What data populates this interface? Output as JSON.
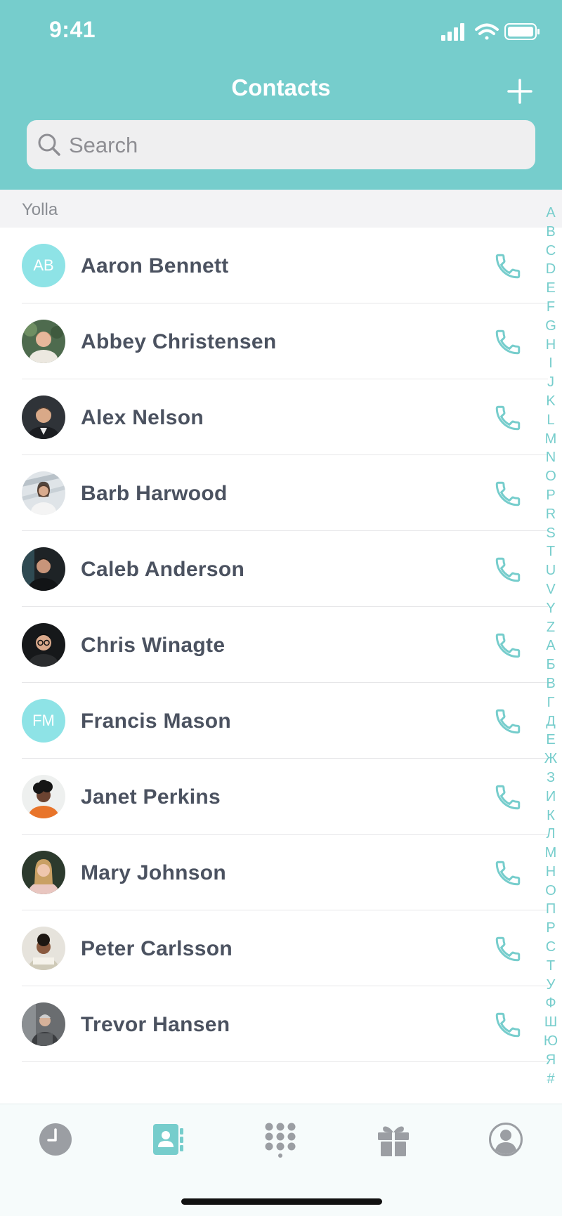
{
  "status_bar": {
    "time": "9:41"
  },
  "header": {
    "title": "Contacts",
    "add_icon": "plus-icon"
  },
  "search": {
    "placeholder": "Search",
    "icon": "search-icon"
  },
  "section": {
    "label": "Yolla"
  },
  "contacts": [
    {
      "name": "Aaron Bennett",
      "initials": "AB",
      "avatar": "initials"
    },
    {
      "name": "Abbey Christensen",
      "initials": "",
      "avatar": "photo"
    },
    {
      "name": "Alex Nelson",
      "initials": "",
      "avatar": "photo"
    },
    {
      "name": "Barb Harwood",
      "initials": "",
      "avatar": "photo"
    },
    {
      "name": "Caleb Anderson",
      "initials": "",
      "avatar": "photo"
    },
    {
      "name": "Chris Winagte",
      "initials": "",
      "avatar": "photo"
    },
    {
      "name": "Francis Mason",
      "initials": "FM",
      "avatar": "initials"
    },
    {
      "name": "Janet Perkins",
      "initials": "",
      "avatar": "photo"
    },
    {
      "name": "Mary Johnson",
      "initials": "",
      "avatar": "photo"
    },
    {
      "name": "Peter Carlsson",
      "initials": "",
      "avatar": "photo"
    },
    {
      "name": "Trevor Hansen",
      "initials": "",
      "avatar": "photo"
    }
  ],
  "index_letters": [
    "A",
    "B",
    "C",
    "D",
    "E",
    "F",
    "G",
    "H",
    "I",
    "J",
    "K",
    "L",
    "M",
    "N",
    "O",
    "P",
    "R",
    "S",
    "T",
    "U",
    "V",
    "Y",
    "Z",
    "А",
    "Б",
    "В",
    "Г",
    "Д",
    "Е",
    "Ж",
    "З",
    "И",
    "К",
    "Л",
    "М",
    "Н",
    "О",
    "П",
    "Р",
    "С",
    "Т",
    "У",
    "Ф",
    "Ш",
    "Ю",
    "Я",
    "#"
  ],
  "tabs": [
    {
      "icon": "clock-icon",
      "active": false
    },
    {
      "icon": "contacts-book-icon",
      "active": true
    },
    {
      "icon": "dialpad-icon",
      "active": false
    },
    {
      "icon": "gift-icon",
      "active": false
    },
    {
      "icon": "profile-icon",
      "active": false
    }
  ],
  "colors": {
    "accent": "#76cdcc",
    "initials_avatar": "#8ee3e6",
    "text": "#4b5260",
    "inactive_icon": "#9b9ea3"
  }
}
